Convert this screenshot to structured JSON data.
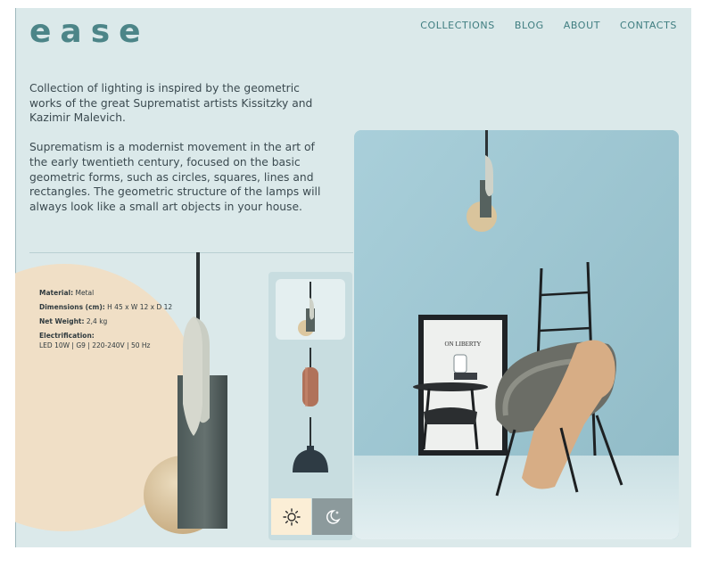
{
  "brand": {
    "logo": "ease"
  },
  "nav": {
    "items": [
      "COLLECTIONS",
      "BLOG",
      "ABOUT",
      "CONTACTS"
    ]
  },
  "intro": {
    "paragraphs": [
      "Collection of lighting is inspired by the geometric works of the great Suprematist artists Kissitzky and Kazimir Malevich.",
      "Suprematism is a modernist movement in the art of the early twentieth century, focused on the basic geometric forms, such as circles, squares, lines and rectangles. The geometric structure of the lamps will always look like a small art objects in your house."
    ]
  },
  "specs": {
    "material_label": "Material:",
    "material_value": "Metal",
    "dimensions_label": "Dimensions (cm):",
    "dimensions_value": "H 45 x W 12 x D 12",
    "weight_label": "Net Weight:",
    "weight_value": "2,4 kg",
    "electrification_label": "Electrification:",
    "electrification_value": "LED 10W | G9 | 220-240V | 50 Hz"
  },
  "poster": {
    "line1": "ON LIBERTY"
  },
  "colors": {
    "background": "#dbe9ea",
    "accent": "#4c8588",
    "beige": "#f0dfc6",
    "lamp_dark": "#5b6866"
  },
  "icons": {
    "day": "sun-icon",
    "night": "moon-icon"
  }
}
